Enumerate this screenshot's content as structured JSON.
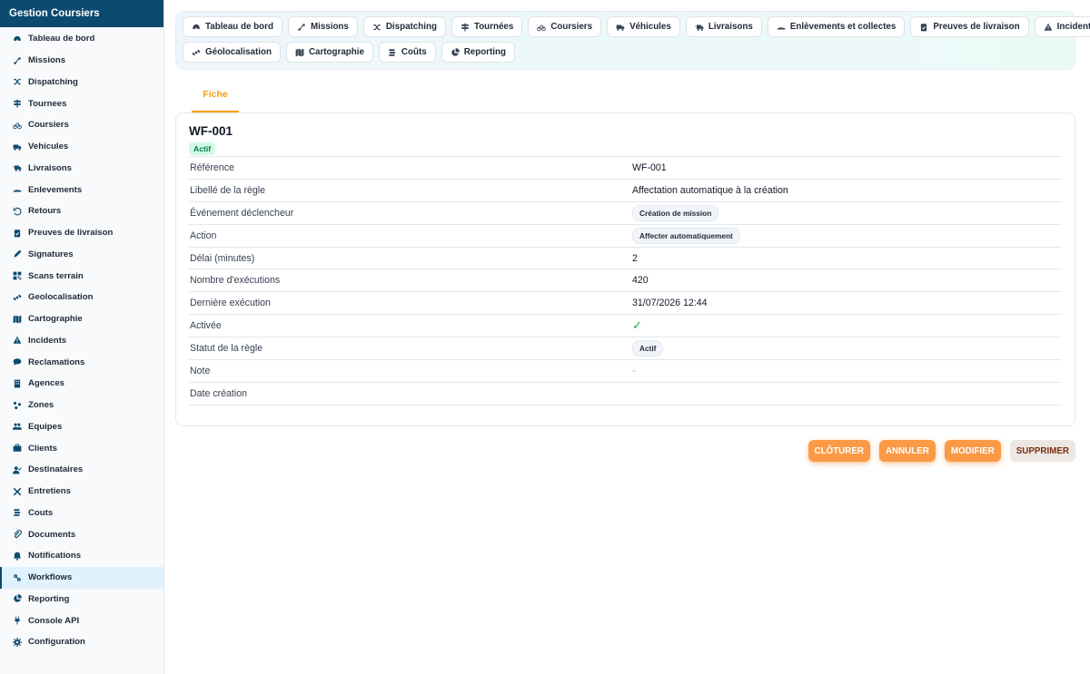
{
  "app": {
    "title": "Gestion Coursiers"
  },
  "sidebar": {
    "items": [
      {
        "label": "Tableau de bord",
        "icon": "gauge-icon"
      },
      {
        "label": "Missions",
        "icon": "route-icon"
      },
      {
        "label": "Dispatching",
        "icon": "shuffle-icon"
      },
      {
        "label": "Tournees",
        "icon": "signs-icon"
      },
      {
        "label": "Coursiers",
        "icon": "bicycle-icon"
      },
      {
        "label": "Vehicules",
        "icon": "truck-icon"
      },
      {
        "label": "Livraisons",
        "icon": "truck-fast-icon"
      },
      {
        "label": "Enlevements",
        "icon": "hand-icon"
      },
      {
        "label": "Retours",
        "icon": "return-icon"
      },
      {
        "label": "Preuves de livraison",
        "icon": "clipboard-check-icon"
      },
      {
        "label": "Signatures",
        "icon": "signature-icon"
      },
      {
        "label": "Scans terrain",
        "icon": "qrcode-icon"
      },
      {
        "label": "Geolocalisation",
        "icon": "satellite-icon"
      },
      {
        "label": "Cartographie",
        "icon": "map-icon"
      },
      {
        "label": "Incidents",
        "icon": "warning-icon"
      },
      {
        "label": "Reclamations",
        "icon": "comment-icon"
      },
      {
        "label": "Agences",
        "icon": "building-icon"
      },
      {
        "label": "Zones",
        "icon": "zones-icon"
      },
      {
        "label": "Equipes",
        "icon": "users-icon"
      },
      {
        "label": "Clients",
        "icon": "briefcase-icon"
      },
      {
        "label": "Destinataires",
        "icon": "user-check-icon"
      },
      {
        "label": "Entretiens",
        "icon": "tools-icon"
      },
      {
        "label": "Couts",
        "icon": "coins-icon"
      },
      {
        "label": "Documents",
        "icon": "paperclip-icon"
      },
      {
        "label": "Notifications",
        "icon": "bell-icon"
      },
      {
        "label": "Workflows",
        "icon": "workflow-icon",
        "active": true
      },
      {
        "label": "Reporting",
        "icon": "pie-chart-icon"
      },
      {
        "label": "Console API",
        "icon": "plug-icon"
      },
      {
        "label": "Configuration",
        "icon": "gear-icon"
      }
    ]
  },
  "tabs": {
    "row1": [
      {
        "label": "Tableau de bord",
        "icon": "gauge-icon"
      },
      {
        "label": "Missions",
        "icon": "route-icon"
      },
      {
        "label": "Dispatching",
        "icon": "shuffle-icon"
      },
      {
        "label": "Tournées",
        "icon": "signs-icon"
      },
      {
        "label": "Coursiers",
        "icon": "bicycle-icon"
      },
      {
        "label": "Véhicules",
        "icon": "truck-icon"
      },
      {
        "label": "Livraisons",
        "icon": "truck-fast-icon"
      },
      {
        "label": "Enlèvements et collectes",
        "icon": "hand-icon"
      },
      {
        "label": "Preuves de livraison",
        "icon": "clipboard-check-icon"
      },
      {
        "label": "Incidents",
        "icon": "warning-icon"
      }
    ],
    "row2": [
      {
        "label": "Géolocalisation",
        "icon": "satellite-icon"
      },
      {
        "label": "Cartographie",
        "icon": "map-icon"
      },
      {
        "label": "Coûts",
        "icon": "coins-icon"
      },
      {
        "label": "Reporting",
        "icon": "pie-chart-icon"
      }
    ]
  },
  "detail": {
    "tab_label": "Fiche",
    "title": "WF-001",
    "status": "Actif",
    "fields": [
      {
        "label": "Référence",
        "value": "WF-001",
        "type": "text"
      },
      {
        "label": "Libellé de la règle",
        "value": "Affectation automatique à la création",
        "type": "text"
      },
      {
        "label": "Événement déclencheur",
        "value": "Création de mission",
        "type": "chip"
      },
      {
        "label": "Action",
        "value": "Affecter automatiquement",
        "type": "chip"
      },
      {
        "label": "Délai (minutes)",
        "value": "2",
        "type": "text"
      },
      {
        "label": "Nombre d'exécutions",
        "value": "420",
        "type": "text"
      },
      {
        "label": "Dernière exécution",
        "value": "31/07/2026 12:44",
        "type": "text"
      },
      {
        "label": "Activée",
        "value": "✓",
        "type": "check"
      },
      {
        "label": "Statut de la règle",
        "value": "Actif",
        "type": "chip"
      },
      {
        "label": "Note",
        "value": "-",
        "type": "muted"
      },
      {
        "label": "Date création",
        "value": "",
        "type": "text"
      }
    ]
  },
  "actions": {
    "cloturer": "CLÔTURER",
    "annuler": "ANNULER",
    "modifier": "MODIFIER",
    "supprimer": "SUPPRIMER"
  },
  "colors": {
    "sidebar_header": "#0c4a6e",
    "accent_orange": "#fb9a46",
    "active_tab": "#f59e0b",
    "check_green": "#16a34a"
  }
}
